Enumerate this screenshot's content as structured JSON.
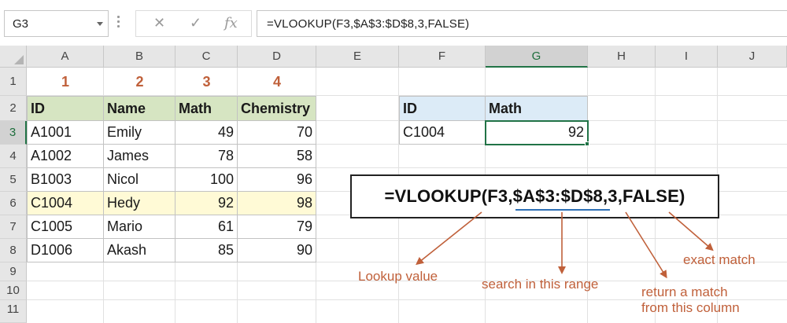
{
  "formula_bar": {
    "name_box": "G3",
    "formula": "=VLOOKUP(F3,$A$3:$D$8,3,FALSE)",
    "cancel_icon": "close-icon",
    "enter_icon": "check-icon",
    "fx_label": "fx"
  },
  "columns": [
    "A",
    "B",
    "C",
    "D",
    "E",
    "F",
    "G",
    "H",
    "I",
    "J"
  ],
  "rows": [
    "1",
    "2",
    "3",
    "4",
    "5",
    "6",
    "7",
    "8",
    "9",
    "10",
    "11"
  ],
  "column_numbers": [
    "1",
    "2",
    "3",
    "4"
  ],
  "table": {
    "headers": [
      "ID",
      "Name",
      "Math",
      "Chemistry"
    ],
    "rows": [
      [
        "A1001",
        "Emily",
        "49",
        "70"
      ],
      [
        "A1002",
        "James",
        "78",
        "58"
      ],
      [
        "B1003",
        "Nicol",
        "100",
        "96"
      ],
      [
        "C1004",
        "Hedy",
        "92",
        "98"
      ],
      [
        "C1005",
        "Mario",
        "61",
        "79"
      ],
      [
        "D1006",
        "Akash",
        "85",
        "90"
      ]
    ]
  },
  "lookup": {
    "headers": [
      "ID",
      "Math"
    ],
    "id_value": "C1004",
    "result": "92"
  },
  "annotation": {
    "formula_prefix": "=VLOOKUP(F3,",
    "formula_range": "$A$3:$D$8",
    "formula_suffix": ",3,FALSE)",
    "lookup_value": "Lookup value",
    "search_range": "search in this range",
    "return_match_line1": "return a match",
    "return_match_line2": "from this column",
    "exact_match": "exact match"
  },
  "colors": {
    "header_green": "#d6e5c2",
    "lookup_header_blue": "#dcebf7",
    "highlight_yellow": "#fffad6",
    "accent_orange": "#c0603a",
    "selection_green": "#217346"
  }
}
